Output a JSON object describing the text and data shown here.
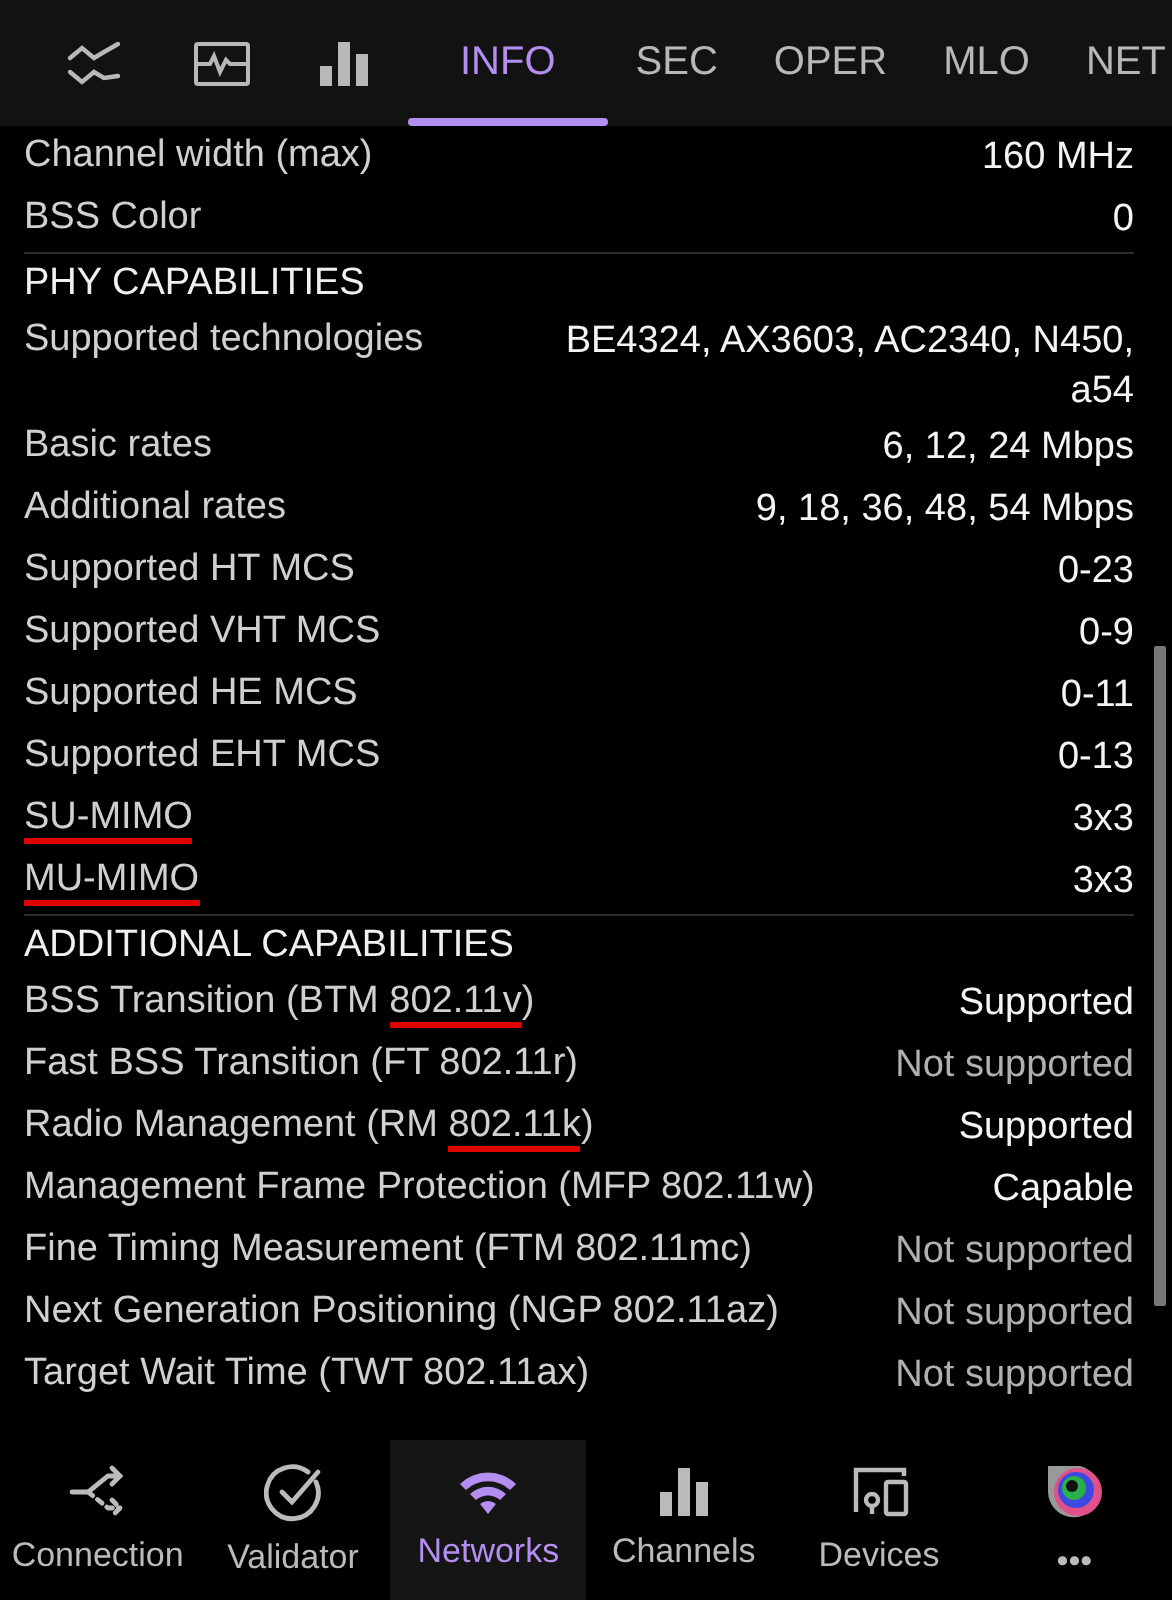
{
  "top_tabs": [
    {
      "kind": "icon",
      "selected": false
    },
    {
      "kind": "icon",
      "selected": false
    },
    {
      "kind": "icon",
      "selected": false
    },
    {
      "kind": "text",
      "label": "INFO",
      "selected": true
    },
    {
      "kind": "text",
      "label": "SEC",
      "selected": false
    },
    {
      "kind": "text",
      "label": "OPER",
      "selected": false
    },
    {
      "kind": "text",
      "label": "MLO",
      "selected": false
    },
    {
      "kind": "text",
      "label": "NET",
      "selected": false
    }
  ],
  "sections": [
    {
      "rows": [
        {
          "label": "Channel width (max)",
          "value": "160 MHz",
          "muted": false
        },
        {
          "label": "BSS Color",
          "value": "0",
          "muted": false
        }
      ]
    },
    {
      "title": "PHY CAPABILITIES",
      "rows": [
        {
          "label": "Supported technologies",
          "value": "BE4324, AX3603, AC2340, N450, a54",
          "muted": false
        },
        {
          "label": "Basic rates",
          "value": "6, 12, 24 Mbps",
          "muted": false
        },
        {
          "label": "Additional rates",
          "value": "9, 18, 36, 48, 54 Mbps",
          "muted": false
        },
        {
          "label": "Supported HT MCS",
          "value": "0-23",
          "muted": false
        },
        {
          "label": "Supported VHT MCS",
          "value": "0-9",
          "muted": false
        },
        {
          "label": "Supported HE MCS",
          "value": "0-11",
          "muted": false
        },
        {
          "label": "Supported EHT MCS",
          "value": "0-13",
          "muted": false
        },
        {
          "underlined": "SU-MIMO",
          "value": "3x3",
          "muted": false
        },
        {
          "underlined": "MU-MIMO",
          "value": "3x3",
          "muted": false
        }
      ]
    },
    {
      "title": "ADDITIONAL CAPABILITIES",
      "rows": [
        {
          "label": "BSS Transition (BTM ",
          "underlined": "802.11v",
          "label_end": ")",
          "value": "Supported",
          "muted": false
        },
        {
          "label": "Fast BSS Transition (FT 802.11r)",
          "value": "Not supported",
          "muted": true
        },
        {
          "label": "Radio Management (RM ",
          "underlined": "802.11k",
          "label_end": ")",
          "value": "Supported",
          "muted": false
        },
        {
          "label": "Management Frame Protection (MFP 802.11w)",
          "value": "Capable",
          "muted": false
        },
        {
          "label": "Fine Timing Measurement (FTM 802.11mc)",
          "value": "Not supported",
          "muted": true
        },
        {
          "label": "Next Generation Positioning (NGP 802.11az)",
          "value": "Not supported",
          "muted": true
        },
        {
          "label": "Target Wait Time (TWT 802.11ax)",
          "value": "Not supported",
          "muted": true
        }
      ]
    }
  ],
  "bottom_nav": [
    {
      "label": "Connection",
      "selected": false
    },
    {
      "label": "Validator",
      "selected": false
    },
    {
      "label": "Networks",
      "selected": true
    },
    {
      "label": "Channels",
      "selected": false
    },
    {
      "label": "Devices",
      "selected": false
    },
    {
      "label": "•••",
      "selected": false
    }
  ]
}
